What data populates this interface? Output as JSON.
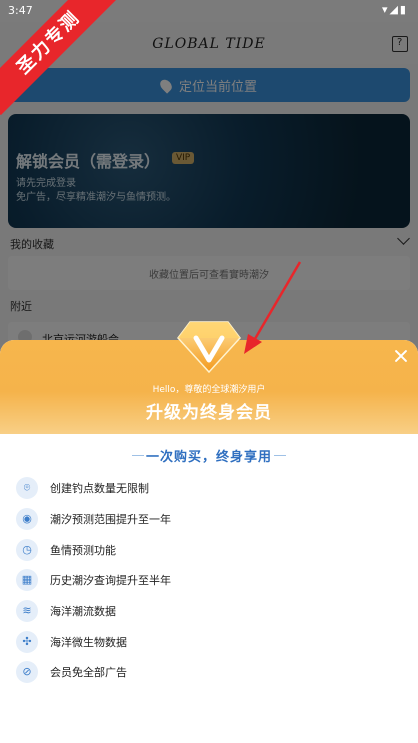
{
  "status_bar": {
    "time": "3:47",
    "icons": "wifi-icon signal-icon battery-icon"
  },
  "app": {
    "logo": "GLOBAL TIDE",
    "locate_label": "定位当前位置",
    "vip_card": {
      "title": "解锁会员（需登录）",
      "badge": "VIP",
      "line1": "请先完成登录",
      "line2": "免广告，尽享精准潮汐与鱼情预测。"
    },
    "favorites_title": "我的收藏",
    "favorites_empty": "收藏位置后可查看實時潮汐",
    "nearby_title": "附近",
    "nearby_item": "北京运河游船会"
  },
  "ribbon_text": "圣力专测",
  "sheet": {
    "hello": "Hello，尊敬的全球潮汐用户",
    "upgrade_title": "升级为终身会员",
    "once_title": "一次购买，终身享用",
    "features": [
      {
        "label": "创建钓点数量无限制",
        "icon": "location-pin-icon",
        "glyph": "⌾"
      },
      {
        "label": "潮汐预测范围提升至一年",
        "icon": "eye-icon",
        "glyph": "◉"
      },
      {
        "label": "鱼情预测功能",
        "icon": "clock-icon",
        "glyph": "◷"
      },
      {
        "label": "历史潮汐查询提升至半年",
        "icon": "calendar-icon",
        "glyph": "▦"
      },
      {
        "label": "海洋潮流数据",
        "icon": "waves-icon",
        "glyph": "≋"
      },
      {
        "label": "海洋微生物数据",
        "icon": "microbe-icon",
        "glyph": "✣"
      },
      {
        "label": "会员免全部广告",
        "icon": "no-ads-icon",
        "glyph": "⊘"
      }
    ]
  },
  "colors": {
    "accent_blue": "#3b93de",
    "gold": "#f5b34b",
    "ribbon_red": "#e8262b"
  }
}
